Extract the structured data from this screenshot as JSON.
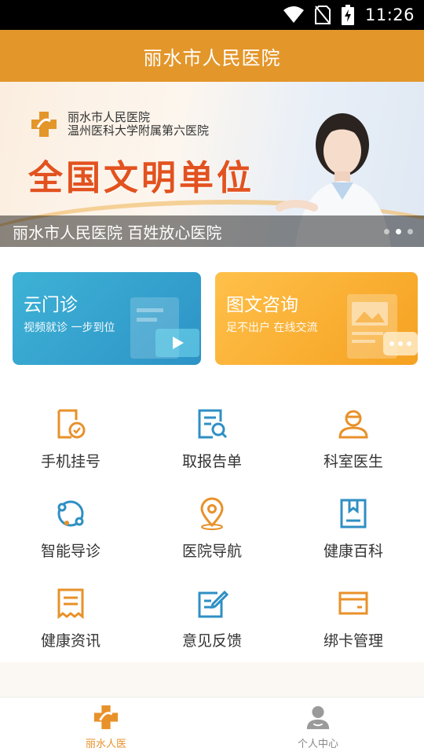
{
  "status_bar": {
    "time": "11:26"
  },
  "header": {
    "title": "丽水市人民医院"
  },
  "banner": {
    "hospital_name": "丽水市人民医院",
    "hospital_subtitle": "温州医科大学附属第六医院",
    "slogan": "全国文明单位",
    "caption": "丽水市人民医院 百姓放心医院",
    "slide_count": 3,
    "active_slide": 2
  },
  "cards": [
    {
      "title": "云门诊",
      "subtitle": "视频就诊 一步到位"
    },
    {
      "title": "图文咨询",
      "subtitle": "足不出户 在线交流"
    }
  ],
  "grid": [
    {
      "label": "手机挂号",
      "icon": "registration-icon"
    },
    {
      "label": "取报告单",
      "icon": "report-search-icon"
    },
    {
      "label": "科室医生",
      "icon": "doctor-icon"
    },
    {
      "label": "智能导诊",
      "icon": "smart-guide-icon"
    },
    {
      "label": "医院导航",
      "icon": "location-pin-icon"
    },
    {
      "label": "健康百科",
      "icon": "encyclopedia-book-icon"
    },
    {
      "label": "健康资讯",
      "icon": "news-document-icon"
    },
    {
      "label": "意见反馈",
      "icon": "feedback-edit-icon"
    },
    {
      "label": "绑卡管理",
      "icon": "card-icon"
    }
  ],
  "tabs": [
    {
      "label": "丽水人医",
      "active": true
    },
    {
      "label": "个人中心",
      "active": false
    }
  ],
  "colors": {
    "brand": "#e3962a",
    "icon_orange": "#e8912a",
    "icon_blue": "#2f8fc4",
    "tab_active": "#e8912a",
    "tab_inactive": "#888888"
  }
}
